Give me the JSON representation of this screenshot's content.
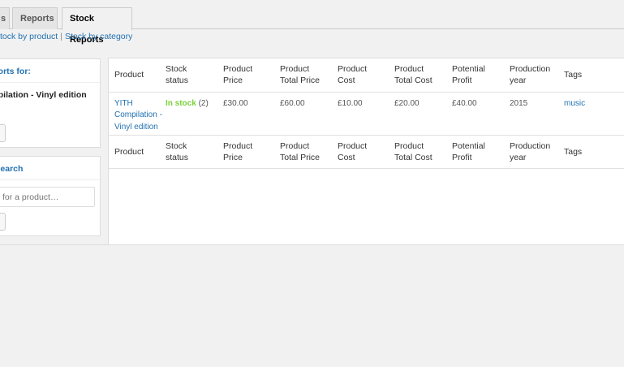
{
  "tabs": {
    "prev_label": "s",
    "reports_label": "Reports",
    "stock_label": "Stock Reports"
  },
  "sublinks": {
    "by_product": "tock by product",
    "separator": "|",
    "by_category": "Stock by category"
  },
  "filter_box": {
    "title": "g reports for:",
    "product_name": "ompilation - Vinyl edition"
  },
  "search_box": {
    "title": "t Search",
    "placeholder": "for a product…"
  },
  "table": {
    "headers": [
      "Product",
      "Stock status",
      "Product Price",
      "Product Total Price",
      "Product Cost",
      "Product Total Cost",
      "Potential Profit",
      "Production year",
      "Tags"
    ],
    "header_lines": [
      [
        "Product",
        ""
      ],
      [
        "Stock",
        "status"
      ],
      [
        "Product",
        "Price"
      ],
      [
        "Product",
        "Total Price"
      ],
      [
        "Product",
        "Cost"
      ],
      [
        "Product",
        "Total Cost"
      ],
      [
        "Potential",
        "Profit"
      ],
      [
        "Production",
        "year"
      ],
      [
        "Tags",
        ""
      ]
    ],
    "rows": [
      {
        "product_lines": [
          "YITH",
          "Compilation -",
          "Vinyl edition"
        ],
        "stock_status": "In stock",
        "stock_qty": "(2)",
        "price": "£30.00",
        "total_price": "£60.00",
        "cost": "£10.00",
        "total_cost": "£20.00",
        "profit": "£40.00",
        "year": "2015",
        "tags": "music"
      }
    ]
  },
  "colors": {
    "link": "#2271b1",
    "in_stock": "#7ad03a",
    "background": "#f1f1f1"
  }
}
